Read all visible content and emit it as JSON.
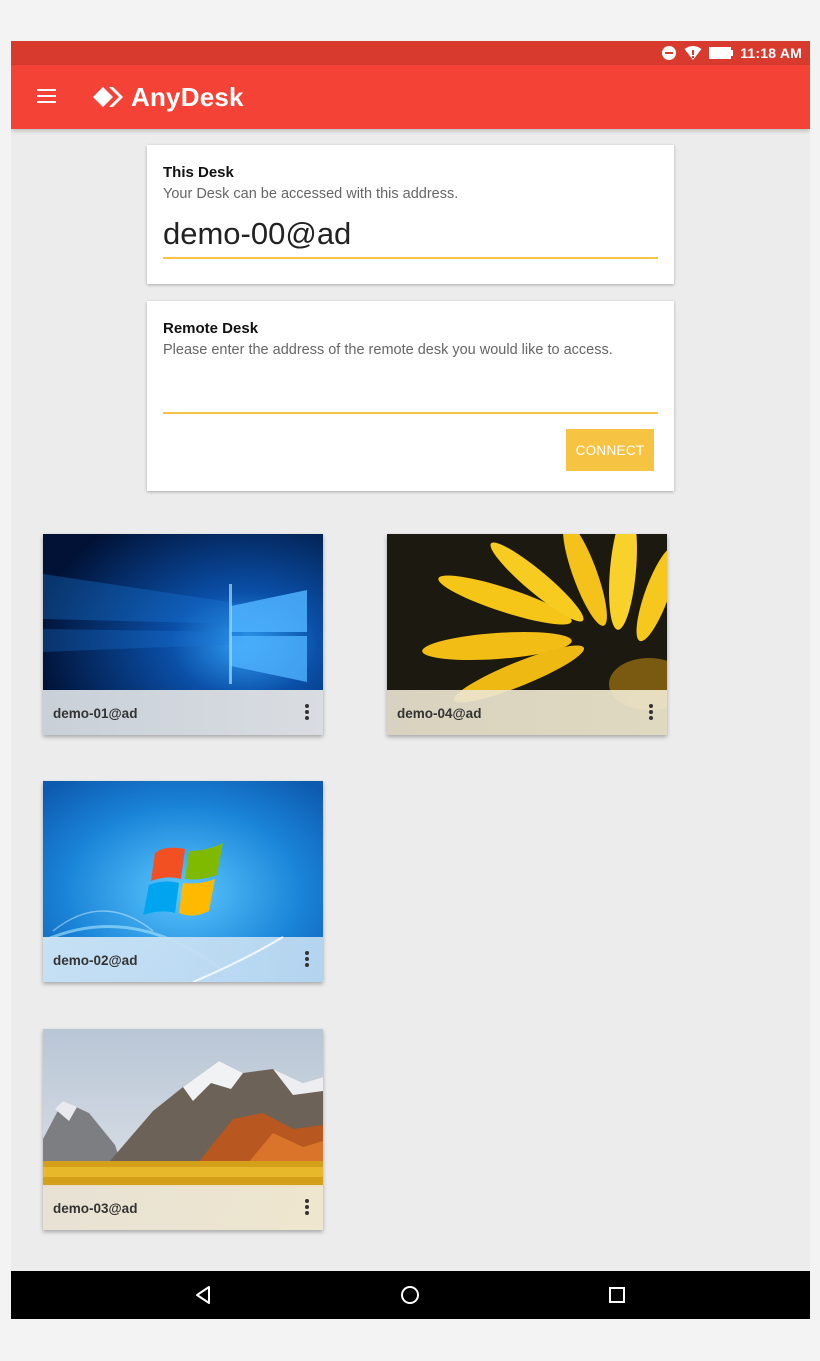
{
  "status_bar": {
    "time": "11:18 AM",
    "icons": [
      "do-not-disturb-icon",
      "wifi-icon",
      "battery-icon"
    ]
  },
  "app_bar": {
    "title": "AnyDesk",
    "menu_icon": "hamburger-menu-icon",
    "brand_color": "#f44336"
  },
  "this_desk": {
    "title": "This Desk",
    "subtitle": "Your Desk can be accessed with this address.",
    "address": "demo-00@ad"
  },
  "remote_desk": {
    "title": "Remote Desk",
    "subtitle": "Please enter the address of the remote desk you would like to access.",
    "input_value": "",
    "connect_label": "CONNECT",
    "accent_color": "#f6c343"
  },
  "recent_sessions": [
    {
      "address": "demo-01@ad",
      "wallpaper": "windows-10-wallpaper"
    },
    {
      "address": "demo-04@ad",
      "wallpaper": "yellow-flower-wallpaper"
    },
    {
      "address": "demo-02@ad",
      "wallpaper": "windows-7-wallpaper"
    },
    {
      "address": "demo-03@ad",
      "wallpaper": "macos-high-sierra-wallpaper"
    }
  ],
  "nav_bar": {
    "buttons": [
      "back-icon",
      "home-icon",
      "recents-icon"
    ]
  }
}
